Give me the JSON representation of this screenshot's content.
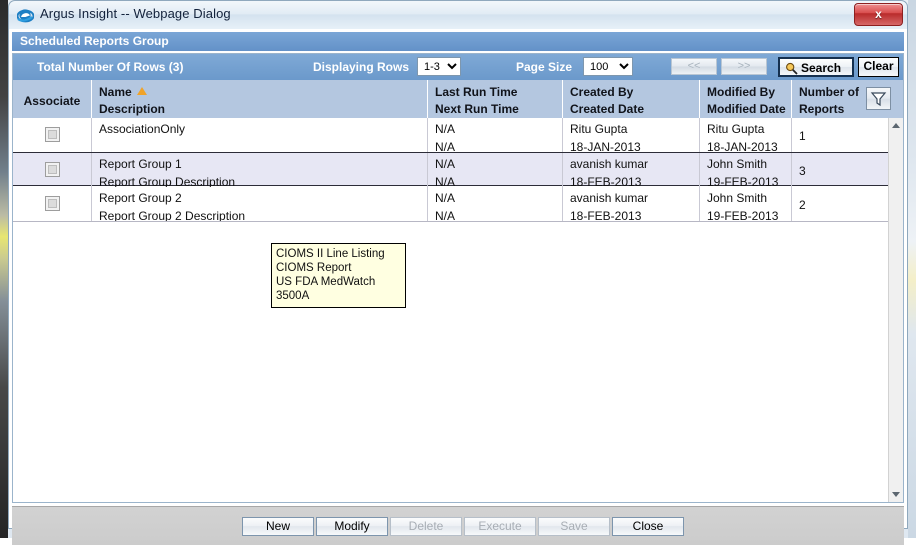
{
  "window": {
    "title": "Argus Insight -- Webpage Dialog",
    "icon": "internet-explorer-icon",
    "close_label": "x"
  },
  "section": {
    "title": "Scheduled Reports Group"
  },
  "toolbar": {
    "total_rows_label": "Total Number Of Rows (3)",
    "displaying_rows_label": "Displaying Rows",
    "displaying_rows_value": "1-3",
    "displaying_rows_options": [
      "1-3"
    ],
    "page_size_label": "Page Size",
    "page_size_value": "100",
    "page_size_options": [
      "100"
    ],
    "prev_label": "<<",
    "next_label": ">>",
    "search_label": "Search",
    "clear_label": "Clear"
  },
  "grid": {
    "headers": {
      "associate": "Associate",
      "name": "Name",
      "description": "Description",
      "last_run_time": "Last Run Time",
      "next_run_time": "Next Run Time",
      "created_by": "Created By",
      "created_date": "Created Date",
      "modified_by": "Modified By",
      "modified_date": "Modified Date",
      "number_of_reports_line1": "Number of",
      "number_of_reports_line2": "Reports"
    },
    "sort": {
      "column": "Name",
      "direction": "ascending"
    },
    "rows": [
      {
        "name": "AssociationOnly",
        "description": "",
        "last_run_time": "N/A",
        "next_run_time": "N/A",
        "created_by": "Ritu Gupta",
        "created_date": "18-JAN-2013",
        "modified_by": "Ritu Gupta",
        "modified_date": "18-JAN-2013",
        "number_of_reports": "1",
        "checked": false,
        "selected": false
      },
      {
        "name": "Report Group 1",
        "description": "Report Group Description",
        "last_run_time": "N/A",
        "next_run_time": "N/A",
        "created_by": "avanish kumar",
        "created_date": "18-FEB-2013",
        "modified_by": "John Smith",
        "modified_date": "19-FEB-2013",
        "number_of_reports": "3",
        "checked": false,
        "selected": true
      },
      {
        "name": "Report Group 2",
        "description": "Report Group 2 Description",
        "last_run_time": "N/A",
        "next_run_time": "N/A",
        "created_by": "avanish kumar",
        "created_date": "18-FEB-2013",
        "modified_by": "John Smith",
        "modified_date": "19-FEB-2013",
        "number_of_reports": "2",
        "checked": false,
        "selected": false
      }
    ]
  },
  "tooltip": {
    "line1": "CIOMS II Line Listing",
    "line2": "CIOMS Report",
    "line3": "US FDA MedWatch 3500A"
  },
  "footer": {
    "buttons": [
      {
        "label": "New",
        "enabled": true
      },
      {
        "label": "Modify",
        "enabled": true
      },
      {
        "label": "Delete",
        "enabled": false
      },
      {
        "label": "Execute",
        "enabled": false
      },
      {
        "label": "Save",
        "enabled": false
      },
      {
        "label": "Close",
        "enabled": true
      }
    ]
  },
  "colors": {
    "title_bar": "#e2ecf5",
    "section_bar": "#6b9bd0",
    "toolbar": "#6b99cb",
    "header_row": "#b4c7e0",
    "selected_row": "#e7e7f4",
    "sort_arrow": "#f0a32a",
    "tooltip_bg": "#ffffe1",
    "close_button": "#d94f4f"
  }
}
